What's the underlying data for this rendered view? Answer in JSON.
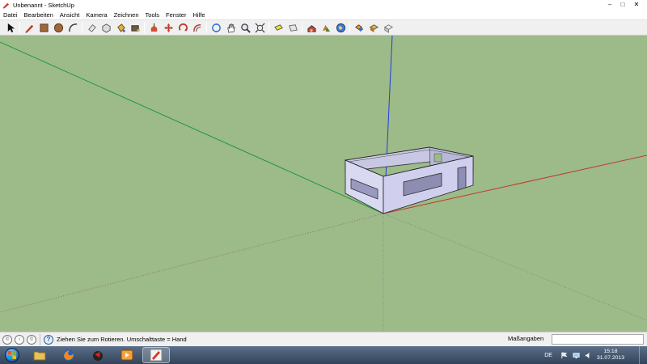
{
  "window": {
    "title": "Unbenannt - SketchUp",
    "controls": {
      "minimize": "–",
      "maximize": "□",
      "close": "✕"
    }
  },
  "menu": {
    "items": [
      "Datei",
      "Bearbeiten",
      "Ansicht",
      "Kamera",
      "Zeichnen",
      "Tools",
      "Fenster",
      "Hilfe"
    ]
  },
  "toolbar": {
    "tools": [
      "select-tool",
      "pencil-tool",
      "rectangle-tool",
      "circle-tool",
      "arc-tool",
      "eraser-tool",
      "make-component-tool",
      "paint-bucket-tool",
      "tape-measure-tool",
      "push-pull-tool",
      "move-tool",
      "rotate-tool",
      "offset-tool",
      "orbit-tool",
      "pan-tool",
      "zoom-tool",
      "zoom-extents-tool",
      "previous-view-tool",
      "next-view-tool",
      "3d-warehouse-tool",
      "share-model-tool",
      "google-earth-tool",
      "component-tool",
      "materials-tool",
      "styles-tool"
    ]
  },
  "statusbar": {
    "hint": "Ziehen Sie zum Rotieren.  Umschalttaste = Hand",
    "measure_label": "Maßangaben",
    "measure_value": "",
    "hint_icon": "?",
    "geo_icon": "©",
    "credit_icon": "i",
    "user_icon": "©"
  },
  "taskbar": {
    "apps": [
      "explorer",
      "firefox",
      "media-center",
      "vlc",
      "sketchup"
    ],
    "language": "DE",
    "time": "15:18",
    "date": "31.07.2013"
  },
  "colors": {
    "sky_ground": "#9dba89",
    "axis_red": "#c0392b",
    "axis_green": "#1f9a3a",
    "axis_blue": "#1f3fd8",
    "wall_face": "#d9d9f2",
    "wall_shadow": "#8f8fb5"
  }
}
